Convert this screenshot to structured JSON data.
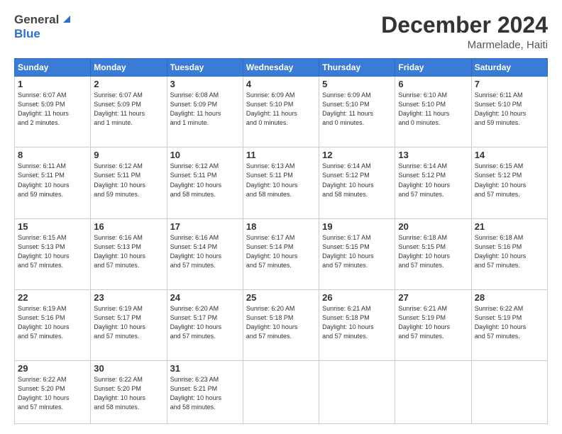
{
  "header": {
    "logo_line1": "General",
    "logo_line2": "Blue",
    "title": "December 2024",
    "location": "Marmelade, Haiti"
  },
  "columns": [
    "Sunday",
    "Monday",
    "Tuesday",
    "Wednesday",
    "Thursday",
    "Friday",
    "Saturday"
  ],
  "weeks": [
    [
      {
        "day": "1",
        "info": "Sunrise: 6:07 AM\nSunset: 5:09 PM\nDaylight: 11 hours\nand 2 minutes."
      },
      {
        "day": "2",
        "info": "Sunrise: 6:07 AM\nSunset: 5:09 PM\nDaylight: 11 hours\nand 1 minute."
      },
      {
        "day": "3",
        "info": "Sunrise: 6:08 AM\nSunset: 5:09 PM\nDaylight: 11 hours\nand 1 minute."
      },
      {
        "day": "4",
        "info": "Sunrise: 6:09 AM\nSunset: 5:10 PM\nDaylight: 11 hours\nand 0 minutes."
      },
      {
        "day": "5",
        "info": "Sunrise: 6:09 AM\nSunset: 5:10 PM\nDaylight: 11 hours\nand 0 minutes."
      },
      {
        "day": "6",
        "info": "Sunrise: 6:10 AM\nSunset: 5:10 PM\nDaylight: 11 hours\nand 0 minutes."
      },
      {
        "day": "7",
        "info": "Sunrise: 6:11 AM\nSunset: 5:10 PM\nDaylight: 10 hours\nand 59 minutes."
      }
    ],
    [
      {
        "day": "8",
        "info": "Sunrise: 6:11 AM\nSunset: 5:11 PM\nDaylight: 10 hours\nand 59 minutes."
      },
      {
        "day": "9",
        "info": "Sunrise: 6:12 AM\nSunset: 5:11 PM\nDaylight: 10 hours\nand 59 minutes."
      },
      {
        "day": "10",
        "info": "Sunrise: 6:12 AM\nSunset: 5:11 PM\nDaylight: 10 hours\nand 58 minutes."
      },
      {
        "day": "11",
        "info": "Sunrise: 6:13 AM\nSunset: 5:11 PM\nDaylight: 10 hours\nand 58 minutes."
      },
      {
        "day": "12",
        "info": "Sunrise: 6:14 AM\nSunset: 5:12 PM\nDaylight: 10 hours\nand 58 minutes."
      },
      {
        "day": "13",
        "info": "Sunrise: 6:14 AM\nSunset: 5:12 PM\nDaylight: 10 hours\nand 57 minutes."
      },
      {
        "day": "14",
        "info": "Sunrise: 6:15 AM\nSunset: 5:12 PM\nDaylight: 10 hours\nand 57 minutes."
      }
    ],
    [
      {
        "day": "15",
        "info": "Sunrise: 6:15 AM\nSunset: 5:13 PM\nDaylight: 10 hours\nand 57 minutes."
      },
      {
        "day": "16",
        "info": "Sunrise: 6:16 AM\nSunset: 5:13 PM\nDaylight: 10 hours\nand 57 minutes."
      },
      {
        "day": "17",
        "info": "Sunrise: 6:16 AM\nSunset: 5:14 PM\nDaylight: 10 hours\nand 57 minutes."
      },
      {
        "day": "18",
        "info": "Sunrise: 6:17 AM\nSunset: 5:14 PM\nDaylight: 10 hours\nand 57 minutes."
      },
      {
        "day": "19",
        "info": "Sunrise: 6:17 AM\nSunset: 5:15 PM\nDaylight: 10 hours\nand 57 minutes."
      },
      {
        "day": "20",
        "info": "Sunrise: 6:18 AM\nSunset: 5:15 PM\nDaylight: 10 hours\nand 57 minutes."
      },
      {
        "day": "21",
        "info": "Sunrise: 6:18 AM\nSunset: 5:16 PM\nDaylight: 10 hours\nand 57 minutes."
      }
    ],
    [
      {
        "day": "22",
        "info": "Sunrise: 6:19 AM\nSunset: 5:16 PM\nDaylight: 10 hours\nand 57 minutes."
      },
      {
        "day": "23",
        "info": "Sunrise: 6:19 AM\nSunset: 5:17 PM\nDaylight: 10 hours\nand 57 minutes."
      },
      {
        "day": "24",
        "info": "Sunrise: 6:20 AM\nSunset: 5:17 PM\nDaylight: 10 hours\nand 57 minutes."
      },
      {
        "day": "25",
        "info": "Sunrise: 6:20 AM\nSunset: 5:18 PM\nDaylight: 10 hours\nand 57 minutes."
      },
      {
        "day": "26",
        "info": "Sunrise: 6:21 AM\nSunset: 5:18 PM\nDaylight: 10 hours\nand 57 minutes."
      },
      {
        "day": "27",
        "info": "Sunrise: 6:21 AM\nSunset: 5:19 PM\nDaylight: 10 hours\nand 57 minutes."
      },
      {
        "day": "28",
        "info": "Sunrise: 6:22 AM\nSunset: 5:19 PM\nDaylight: 10 hours\nand 57 minutes."
      }
    ],
    [
      {
        "day": "29",
        "info": "Sunrise: 6:22 AM\nSunset: 5:20 PM\nDaylight: 10 hours\nand 57 minutes."
      },
      {
        "day": "30",
        "info": "Sunrise: 6:22 AM\nSunset: 5:20 PM\nDaylight: 10 hours\nand 58 minutes."
      },
      {
        "day": "31",
        "info": "Sunrise: 6:23 AM\nSunset: 5:21 PM\nDaylight: 10 hours\nand 58 minutes."
      },
      null,
      null,
      null,
      null
    ]
  ]
}
